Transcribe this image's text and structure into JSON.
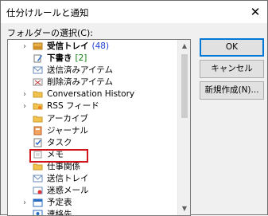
{
  "dialog": {
    "title": "仕分けルールと通知",
    "close_glyph": "✕",
    "folder_label": "フォルダーの選択(C):"
  },
  "tree": {
    "items": [
      {
        "label": "受信トレイ",
        "count": "(48)",
        "count_style": "blue",
        "bold": true,
        "expander": "›",
        "icon": "inbox-icon",
        "indent": 1
      },
      {
        "label": "下書き",
        "count": "[2]",
        "count_style": "green",
        "bold": true,
        "expander": "",
        "icon": "drafts-icon",
        "indent": 1
      },
      {
        "label": "送信済みアイテム",
        "count": "",
        "bold": false,
        "expander": "",
        "icon": "sent-items-icon",
        "indent": 1
      },
      {
        "label": "削除済みアイテム",
        "count": "",
        "bold": false,
        "expander": "",
        "icon": "deleted-items-icon",
        "indent": 1
      },
      {
        "label": "Conversation History",
        "count": "",
        "bold": false,
        "expander": "›",
        "icon": "folder-icon",
        "indent": 1
      },
      {
        "label": "RSS フィード",
        "count": "",
        "bold": false,
        "expander": "›",
        "icon": "rss-feed-icon",
        "indent": 1
      },
      {
        "label": "アーカイブ",
        "count": "",
        "bold": false,
        "expander": "",
        "icon": "archive-folder-icon",
        "indent": 1
      },
      {
        "label": "ジャーナル",
        "count": "",
        "bold": false,
        "expander": "",
        "icon": "journal-icon",
        "indent": 1
      },
      {
        "label": "タスク",
        "count": "",
        "bold": false,
        "expander": "",
        "icon": "tasks-icon",
        "indent": 1
      },
      {
        "label": "メモ",
        "count": "",
        "bold": false,
        "expander": "",
        "icon": "notes-icon",
        "indent": 1
      },
      {
        "label": "仕事関係",
        "count": "",
        "bold": false,
        "expander": "",
        "icon": "folder-icon",
        "indent": 1
      },
      {
        "label": "送信トレイ",
        "count": "",
        "bold": false,
        "expander": "",
        "icon": "outbox-icon",
        "indent": 1
      },
      {
        "label": "迷惑メール",
        "count": "",
        "bold": false,
        "expander": "",
        "icon": "junk-mail-icon",
        "indent": 1
      },
      {
        "label": "予定表",
        "count": "",
        "bold": false,
        "expander": "›",
        "icon": "calendar-icon",
        "indent": 1
      },
      {
        "label": "連絡先",
        "count": "",
        "bold": false,
        "expander": "",
        "icon": "contacts-icon",
        "indent": 1
      }
    ],
    "highlighted_item": "仕事関係"
  },
  "buttons": {
    "ok": "OK",
    "cancel": "キャンセル",
    "new_folder": "新規作成(N)..."
  },
  "colors": {
    "highlight_border": "#d0151c",
    "count_blue": "#1a3fd6",
    "count_green": "#107c10"
  }
}
